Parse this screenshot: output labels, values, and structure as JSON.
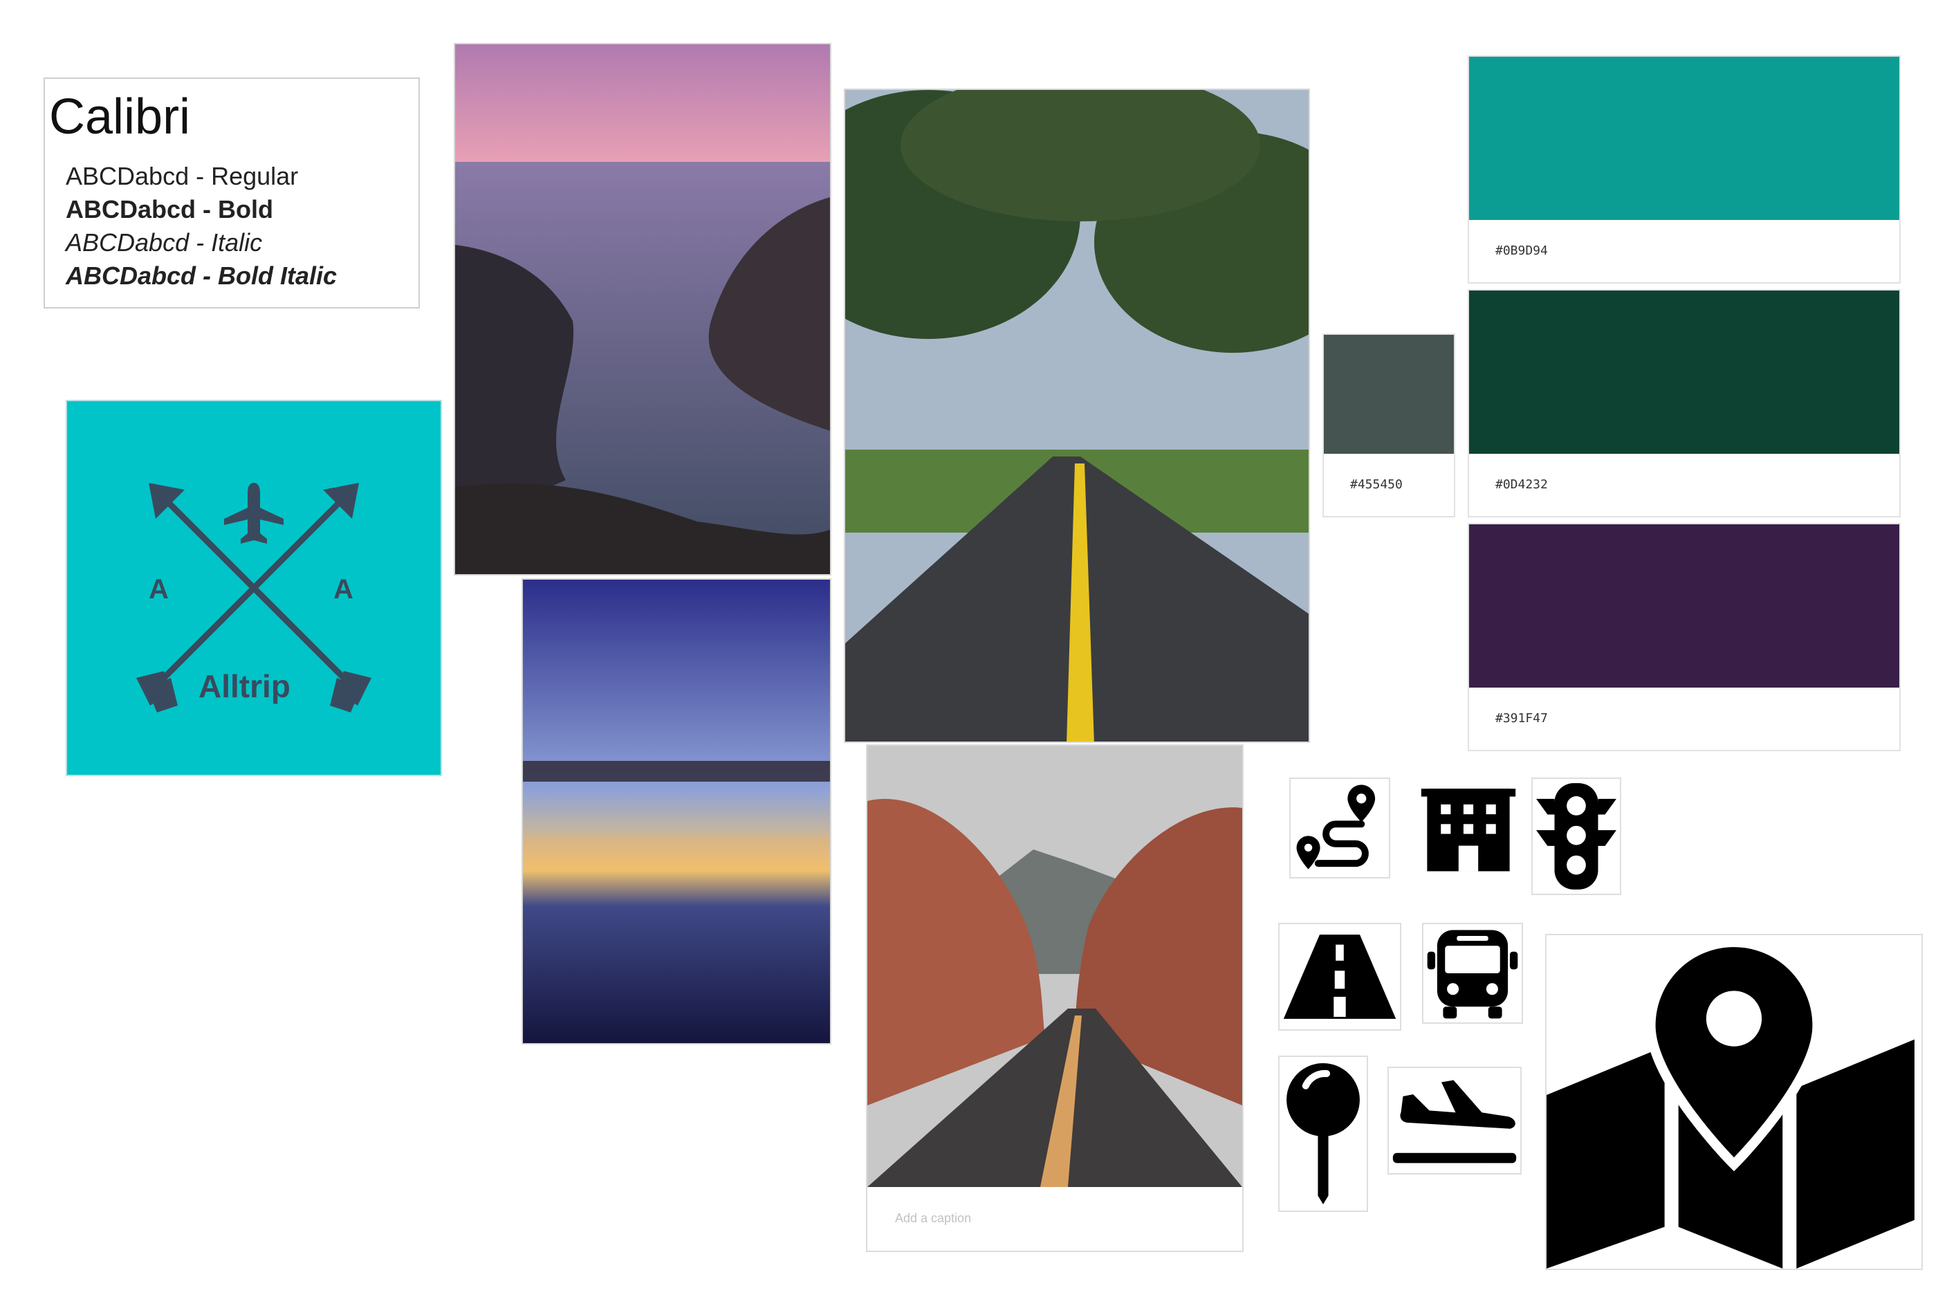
{
  "typography": {
    "family": "Calibri",
    "samples": [
      {
        "label": "ABCDabcd - Regular"
      },
      {
        "label": "ABCDabcd - Bold"
      },
      {
        "label": "ABCDabcd - Italic"
      },
      {
        "label": "ABCDabcd - Bold Italic"
      }
    ]
  },
  "logo": {
    "brand": "Alltrip",
    "left_letter": "A",
    "right_letter": "A",
    "background_color": "#00C4C8",
    "ink_color": "#3A4A5E"
  },
  "palette": {
    "swatches": [
      {
        "hex": "#0B9D94",
        "label": "#0B9D94"
      },
      {
        "hex": "#0D4232",
        "label": "#0D4232"
      },
      {
        "hex": "#391F47",
        "label": "#391F47"
      },
      {
        "hex": "#455450",
        "label": "#455450"
      }
    ]
  },
  "photos": {
    "caption_placeholder": "Add a caption"
  },
  "icons": [
    "route-icon",
    "hotel-icon",
    "traffic-light-icon",
    "road-icon",
    "bus-icon",
    "map-pin-icon",
    "airplane-landing-icon",
    "map-location-icon"
  ]
}
